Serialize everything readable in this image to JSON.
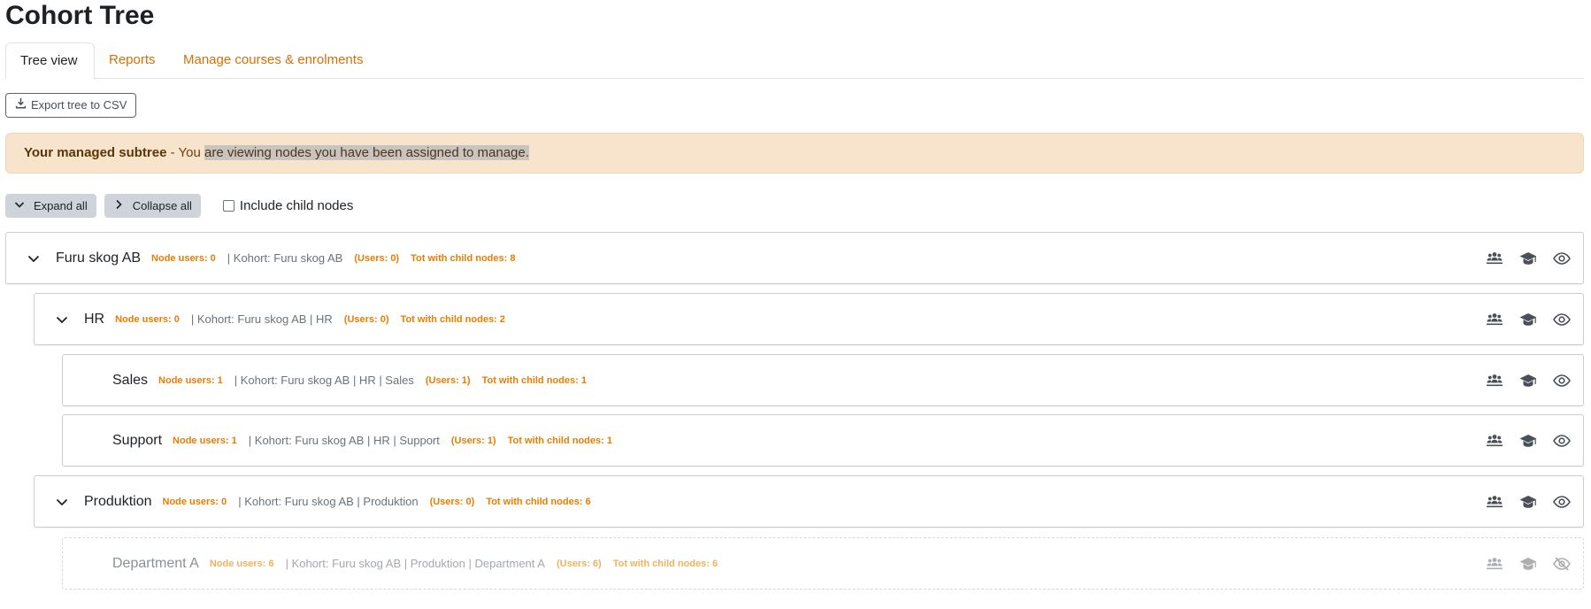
{
  "page": {
    "title": "Cohort Tree"
  },
  "tabs": [
    {
      "label": "Tree view",
      "active": true
    },
    {
      "label": "Reports",
      "active": false
    },
    {
      "label": "Manage courses & enrolments",
      "active": false
    }
  ],
  "toolbar": {
    "export_label": "Export tree to CSV"
  },
  "alert": {
    "strong": "Your managed subtree",
    "text_prefix": " - You ",
    "text_highlight": "are viewing nodes you have been assigned to manage."
  },
  "controls": {
    "expand_all": "Expand all",
    "collapse_all": "Collapse all",
    "include_child_label": "Include child nodes",
    "include_child_checked": false
  },
  "tree": [
    {
      "name": "Furu skog AB",
      "node_users": "Node users: 0",
      "kohort": "| Kohort: Furu skog AB",
      "users": "(Users: 0)",
      "tot": "Tot with child nodes: 8",
      "expanded": true,
      "visible": true
    },
    {
      "name": "HR",
      "node_users": "Node users: 0",
      "kohort": "| Kohort: Furu skog AB | HR",
      "users": "(Users: 0)",
      "tot": "Tot with child nodes: 2",
      "expanded": true,
      "visible": true
    },
    {
      "name": "Sales",
      "node_users": "Node users: 1",
      "kohort": "| Kohort: Furu skog AB | HR | Sales",
      "users": "(Users: 1)",
      "tot": "Tot with child nodes: 1",
      "expanded": false,
      "visible": true
    },
    {
      "name": "Support",
      "node_users": "Node users: 1",
      "kohort": "| Kohort: Furu skog AB | HR | Support",
      "users": "(Users: 1)",
      "tot": "Tot with child nodes: 1",
      "expanded": false,
      "visible": true
    },
    {
      "name": "Produktion",
      "node_users": "Node users: 0",
      "kohort": "| Kohort: Furu skog AB | Produktion",
      "users": "(Users: 0)",
      "tot": "Tot with child nodes: 6",
      "expanded": true,
      "visible": true
    },
    {
      "name": "Department A",
      "node_users": "Node users: 6",
      "kohort": "| Kohort: Furu skog AB | Produktion | Department A",
      "users": "(Users: 6)",
      "tot": "Tot with child nodes: 6",
      "expanded": false,
      "visible": false
    }
  ],
  "colors": {
    "accent": "#e67e00",
    "link": "#d4700a",
    "alert_bg": "#f8e4cc"
  },
  "icons": {
    "users": "users-icon",
    "course": "graduation-cap-icon",
    "visible": "eye-icon",
    "hidden": "eye-slash-icon"
  }
}
